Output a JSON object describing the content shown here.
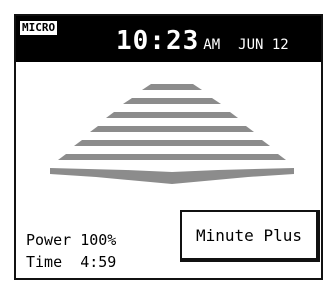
{
  "header": {
    "badge": "MICRO",
    "time": "10:23",
    "ampm": "AM",
    "date": "JUN 12"
  },
  "graphic": {
    "icon": "microwave-waves-icon",
    "color": "#8c8c8c"
  },
  "status": {
    "power_label": "Power",
    "power_value": "100%",
    "time_label": "Time",
    "time_value": "4:59"
  },
  "controls": {
    "minute_plus_label": "Minute Plus"
  },
  "colors": {
    "header_bg": "#000000",
    "header_text": "#ffffff",
    "wave": "#8c8c8c",
    "border": "#111111"
  }
}
